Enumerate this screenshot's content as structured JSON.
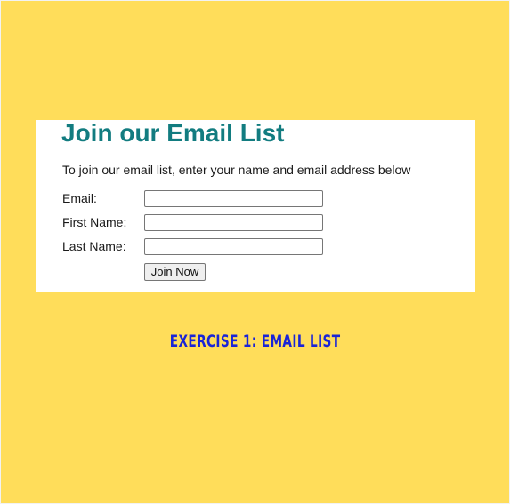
{
  "card": {
    "title": "Join our Email List",
    "intro": "To join our email list, enter your name and email address below",
    "fields": {
      "email": {
        "label": "Email:",
        "value": "",
        "placeholder": ""
      },
      "first_name": {
        "label": "First Name:",
        "value": "",
        "placeholder": ""
      },
      "last_name": {
        "label": "Last Name:",
        "value": "",
        "placeholder": ""
      }
    },
    "submit_label": "Join Now"
  },
  "caption": "EXERCISE 1: EMAIL LIST",
  "colors": {
    "background": "#ffdd5a",
    "card_background": "#ffffff",
    "title": "#127c80",
    "caption": "#1a24d6"
  }
}
